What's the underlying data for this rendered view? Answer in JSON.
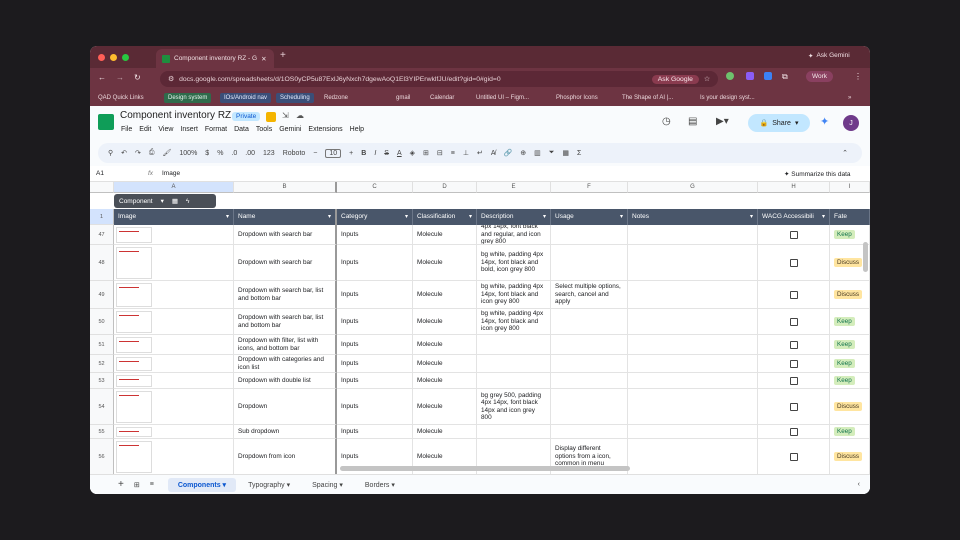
{
  "browser": {
    "tab_title": "Component inventory RZ - G",
    "url": "docs.google.com/spreadsheets/d/1OS0yCP5u87ExlJ6yNxch7dgewAoQ1El3YIPErwklfJU/edit?gid=0#gid=0",
    "ask_gemini": "Ask Gemini",
    "ask_google": "Ask Google",
    "profile": "Work",
    "bookmarks": [
      "QAD Quick Links",
      "Design system",
      "IOs/Android nav",
      "Scheduling",
      "Redzone",
      "gmail",
      "Calendar",
      "Untitled UI – Figm...",
      "Phosphor Icons",
      "The Shape of AI |...",
      "Is your design syst..."
    ]
  },
  "doc": {
    "title": "Component inventory RZ",
    "badge": "Private",
    "menus": [
      "File",
      "Edit",
      "View",
      "Insert",
      "Format",
      "Data",
      "Tools",
      "Gemini",
      "Extensions",
      "Help"
    ],
    "share": "Share",
    "avatar": "J"
  },
  "toolbar": {
    "zoom": "100%",
    "currency": "$",
    "percent": "%",
    "dec1": ".0",
    "dec2": ".00",
    "numfmt": "123",
    "font": "Roboto",
    "size": "10"
  },
  "formula": {
    "cell": "A1",
    "fx": "fx",
    "value": "Image",
    "summarize": "Summarize this data"
  },
  "columns": [
    "A",
    "B",
    "C",
    "D",
    "E",
    "F",
    "G",
    "H",
    "I"
  ],
  "table_chip": "Component",
  "headers": [
    "Image",
    "Name",
    "Category",
    "Classification",
    "Description",
    "Usage",
    "Notes",
    "WACG Accessibili",
    "Fate"
  ],
  "rows": [
    {
      "n": "47",
      "name": "Dropdown with search bar",
      "cat": "Inputs",
      "cls": "Molecule",
      "desc": "4px 14px, font black and regular, and icon grey 800",
      "usage": "",
      "fate": "Keep"
    },
    {
      "n": "48",
      "name": "Dropdown with search bar",
      "cat": "Inputs",
      "cls": "Molecule",
      "desc": "bg white, padding 4px 14px, font black and bold, icon grey 800",
      "usage": "",
      "fate": "Discuss"
    },
    {
      "n": "49",
      "name": "Dropdown with search bar, list and bottom bar",
      "cat": "Inputs",
      "cls": "Molecule",
      "desc": "bg white, padding 4px 14px, font black and icon grey 800",
      "usage": "Select multiple options, search, cancel and apply",
      "fate": "Discuss"
    },
    {
      "n": "50",
      "name": "Dropdown with search bar, list and bottom bar",
      "cat": "Inputs",
      "cls": "Molecule",
      "desc": "bg white, padding 4px 14px, font black and icon grey 800",
      "usage": "",
      "fate": "Keep"
    },
    {
      "n": "51",
      "name": "Dropdown with filter, list with icons, and bottom bar",
      "cat": "Inputs",
      "cls": "Molecule",
      "desc": "",
      "usage": "",
      "fate": "Keep"
    },
    {
      "n": "52",
      "name": "Dropdown with categories and icon list",
      "cat": "Inputs",
      "cls": "Molecule",
      "desc": "",
      "usage": "",
      "fate": "Keep"
    },
    {
      "n": "53",
      "name": "Dropdown with double list",
      "cat": "Inputs",
      "cls": "Molecule",
      "desc": "",
      "usage": "",
      "fate": "Keep"
    },
    {
      "n": "54",
      "name": "Dropdown",
      "cat": "Inputs",
      "cls": "Molecule",
      "desc": "bg grey 500, padding 4px 14px, font black 14px and icon grey 800",
      "usage": "",
      "fate": "Discuss"
    },
    {
      "n": "55",
      "name": "Sub dropdown",
      "cat": "Inputs",
      "cls": "Molecule",
      "desc": "",
      "usage": "",
      "fate": "Keep"
    },
    {
      "n": "56",
      "name": "Dropdown from icon",
      "cat": "Inputs",
      "cls": "Molecule",
      "desc": "",
      "usage": "Display different options from a icon, common in menu",
      "fate": "Discuss"
    }
  ],
  "sheets": [
    "Components",
    "Typography",
    "Spacing",
    "Borders"
  ],
  "colors": {
    "keep_bg": "#d4edbc",
    "discuss_bg": "#ffe5a0",
    "header_bg": "#49566a"
  }
}
